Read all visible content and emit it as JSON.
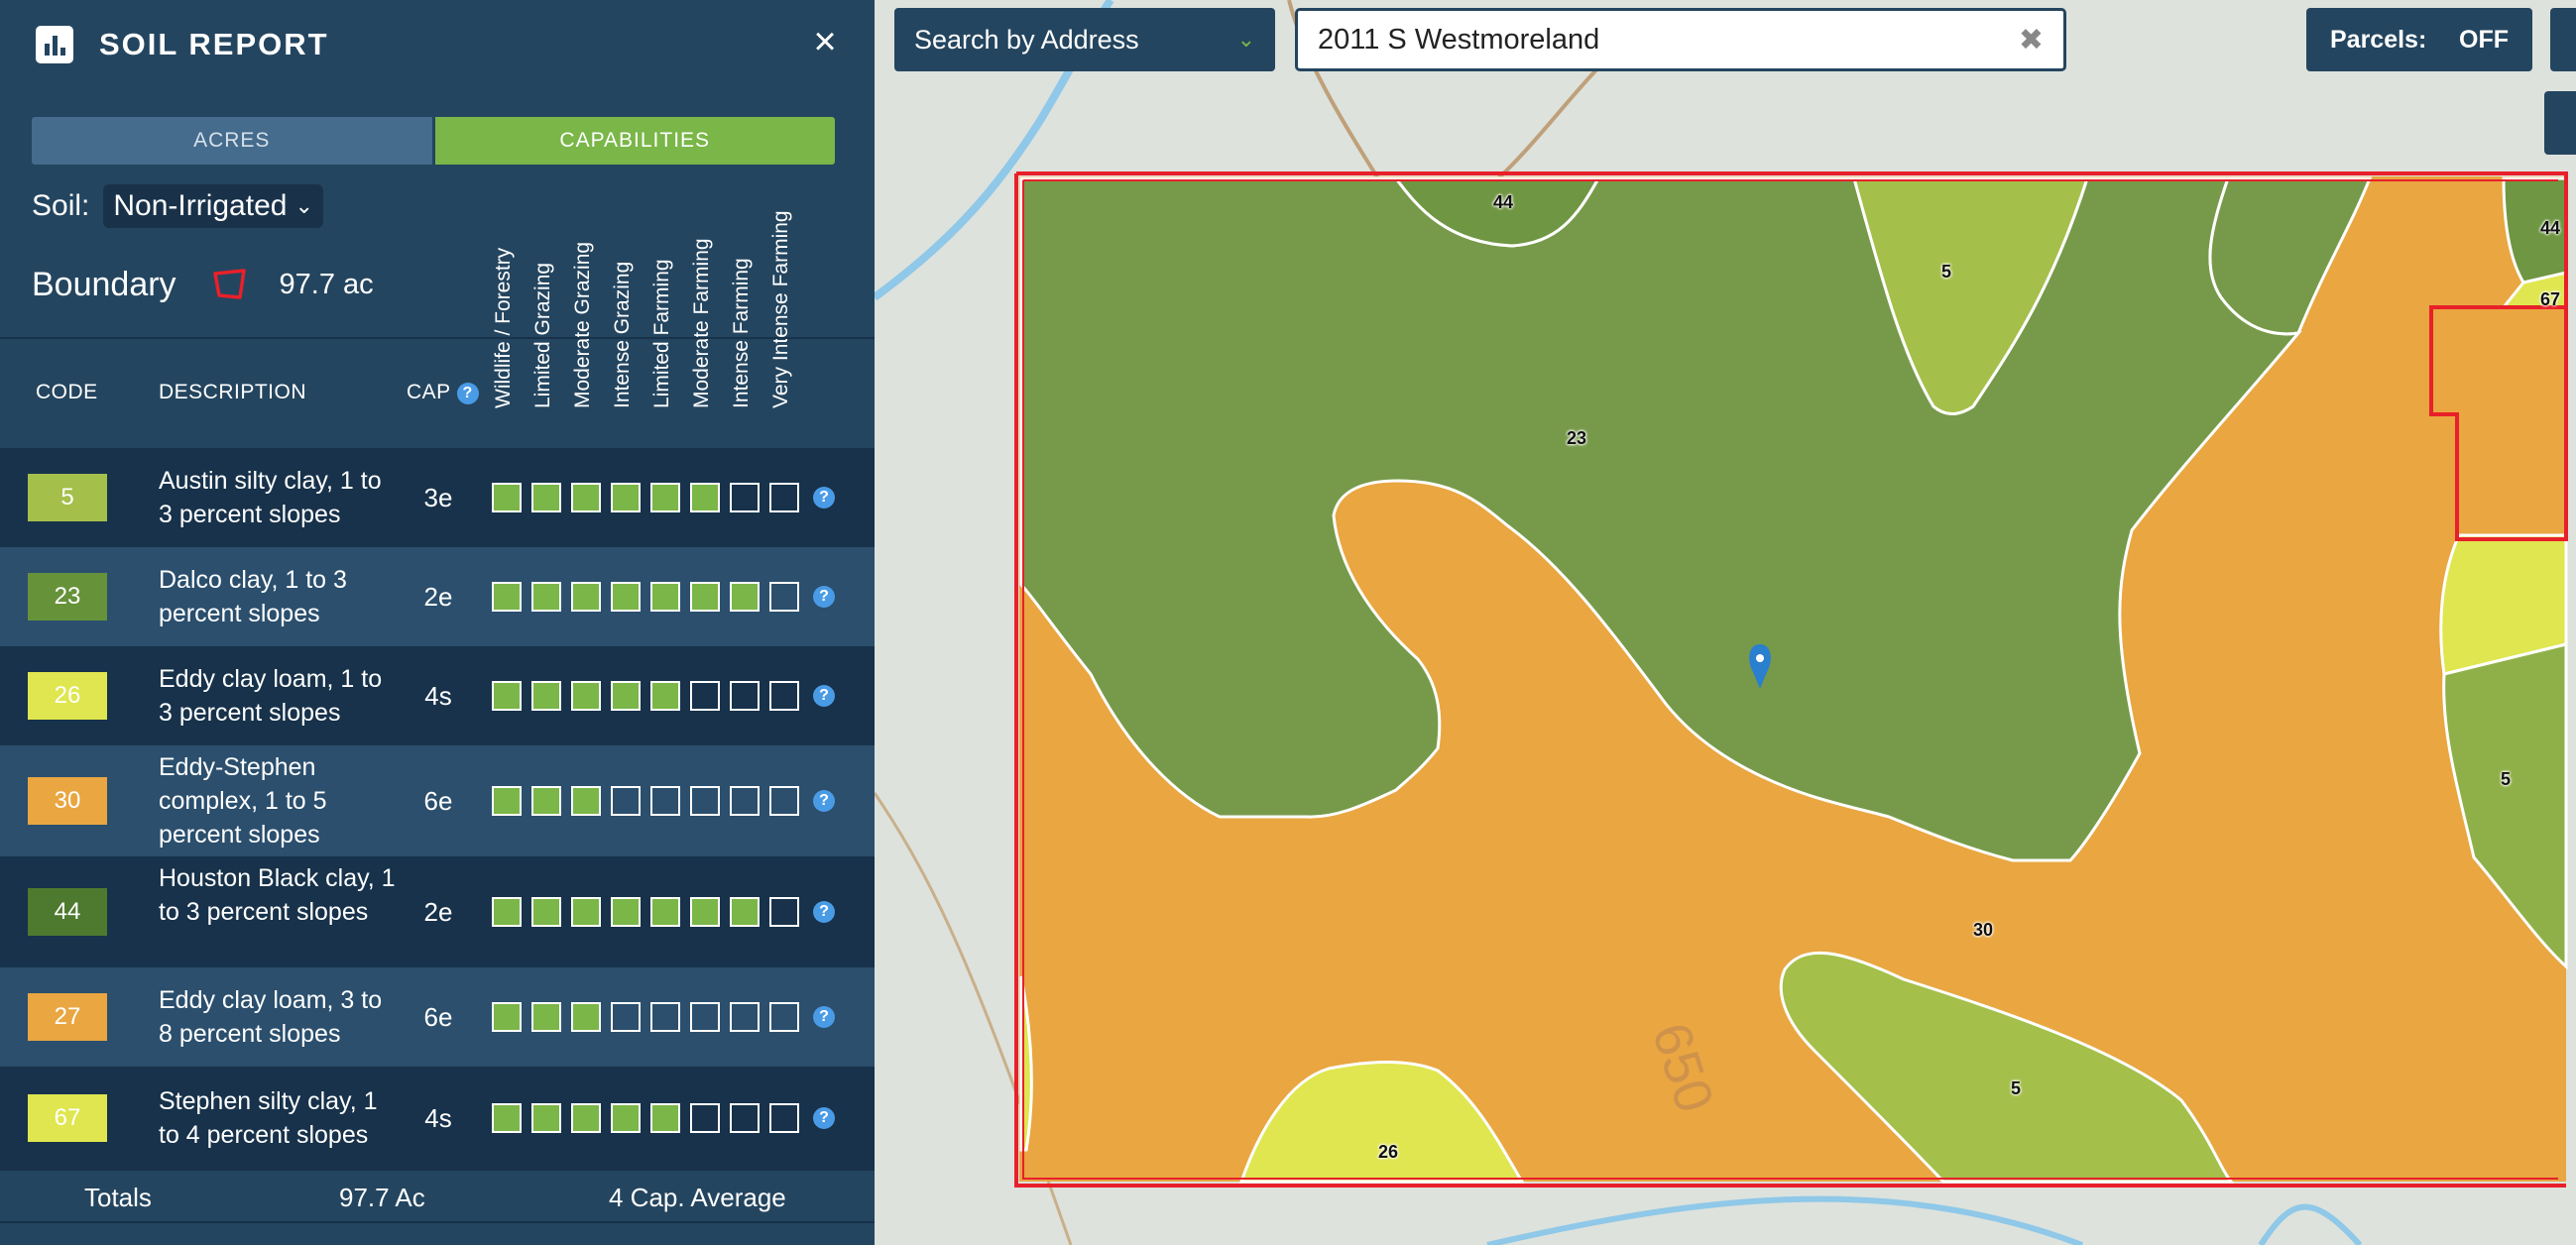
{
  "sidebar": {
    "title": "SOIL REPORT",
    "close": "×",
    "tabs": {
      "acres": "ACRES",
      "capabilities": "CAPABILITIES"
    },
    "soil_label": "Soil:",
    "soil_value": "Non-Irrigated",
    "boundary_label": "Boundary",
    "boundary_acres": "97.7 ac",
    "capability_headers": [
      "Wildlife / Forestry",
      "Limited Grazing",
      "Moderate Grazing",
      "Intense Grazing",
      "Limited Farming",
      "Moderate Farming",
      "Intense Farming",
      "Very Intense Farming"
    ],
    "columns": {
      "code": "CODE",
      "description": "DESCRIPTION",
      "cap": "CAP"
    },
    "help": "?",
    "rows": [
      {
        "code": "5",
        "color": "#a4bf4a",
        "desc": "Austin silty clay, 1 to 3 percent slopes",
        "cap": "3e",
        "level": 6
      },
      {
        "code": "23",
        "color": "#66923a",
        "desc": "Dalco clay, 1 to 3 percent slopes",
        "cap": "2e",
        "level": 7
      },
      {
        "code": "26",
        "color": "#dfe64f",
        "desc": "Eddy clay loam, 1 to 3 percent slopes",
        "cap": "4s",
        "level": 5
      },
      {
        "code": "30",
        "color": "#e9a641",
        "desc": "Eddy-Stephen complex, 1 to 5 percent slopes",
        "cap": "6e",
        "level": 3
      },
      {
        "code": "44",
        "color": "#4d7a2f",
        "desc": "Houston Black clay, 1 to 3 percent slopes",
        "cap": "2e",
        "level": 7
      },
      {
        "code": "27",
        "color": "#e9a641",
        "desc": "Eddy clay loam, 3 to 8 percent slopes",
        "cap": "6e",
        "level": 3
      },
      {
        "code": "67",
        "color": "#dfe64f",
        "desc": "Stephen silty clay, 1 to 4 percent slopes",
        "cap": "4s",
        "level": 5
      }
    ],
    "totals": {
      "label": "Totals",
      "acres": "97.7 Ac",
      "average": "4 Cap. Average"
    }
  },
  "map": {
    "search_mode": "Search by Address",
    "search_value": "2011 S Westmoreland",
    "clear": "✖",
    "parcels_label": "Parcels:",
    "parcels_state": "OFF",
    "labels": {
      "a": "44",
      "b": "5",
      "c": "23",
      "d": "44",
      "e": "67",
      "f": "5",
      "g": "30",
      "h": "5",
      "i": "26",
      "j": "650"
    }
  },
  "colors": {
    "accent": "#7ab648",
    "panel": "#24455f",
    "boundary": "#e8202a",
    "orange": "#e9a641",
    "green": "#779a4a",
    "light_green": "#a4bf4a",
    "yellow": "#dfe64f"
  }
}
